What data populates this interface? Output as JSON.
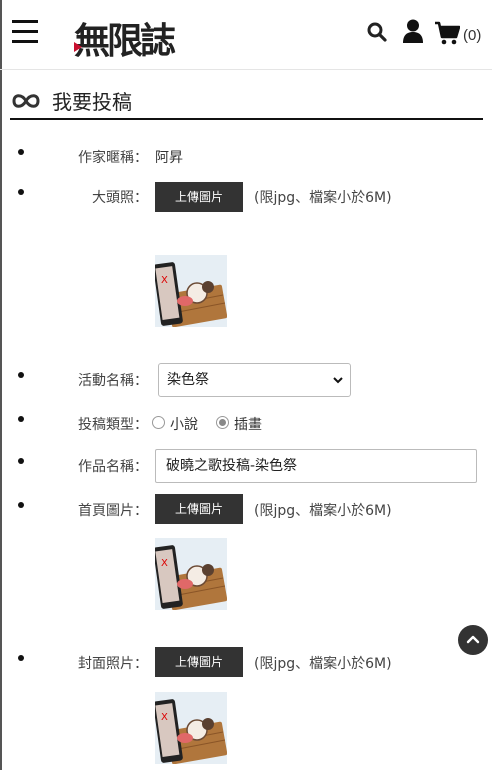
{
  "header": {
    "menu_icon": "hamburger-menu-icon",
    "logo_text": "無限誌",
    "search_icon": "search-icon",
    "user_icon": "user-icon",
    "cart_icon": "cart-icon",
    "cart_count": "(0)"
  },
  "page": {
    "title": "我要投稿",
    "title_icon": "infinity-icon"
  },
  "form": {
    "author": {
      "label": "作家暱稱：",
      "value": "阿昇"
    },
    "avatar": {
      "label": "大頭照：",
      "button": "上傳圖片",
      "hint": "(限jpg、檔案小於6M)"
    },
    "activity": {
      "label": "活動名稱：",
      "selected": "染色祭"
    },
    "type": {
      "label": "投稿類型：",
      "options": [
        "小說",
        "插畫"
      ],
      "selected": "插畫"
    },
    "work_name": {
      "label": "作品名稱：",
      "value": "破曉之歌投稿-染色祭"
    },
    "home_image": {
      "label": "首頁圖片：",
      "button": "上傳圖片",
      "hint": "(限jpg、檔案小於6M)"
    },
    "cover_image": {
      "label": "封面照片：",
      "button": "上傳圖片",
      "hint": "(限jpg、檔案小於6M)"
    }
  },
  "back_to_top_icon": "chevron-up-icon"
}
